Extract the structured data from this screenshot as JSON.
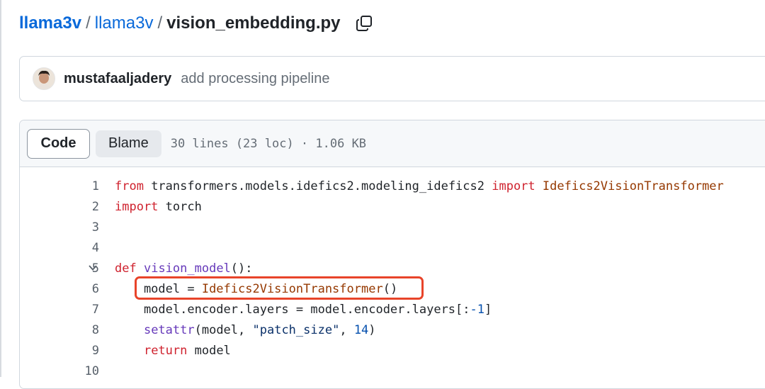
{
  "breadcrumb": {
    "owner": "llama3v",
    "repo": "llama3v",
    "separator": "/",
    "file": "vision_embedding.py"
  },
  "commit": {
    "author": "mustafaaljadery",
    "message": "add processing pipeline"
  },
  "file_header": {
    "code_label": "Code",
    "blame_label": "Blame",
    "meta": "30 lines (23 loc) · 1.06 KB"
  },
  "code": {
    "lines": [
      {
        "num": "1",
        "tokens": [
          {
            "t": "from",
            "c": "kw2"
          },
          {
            "t": " transformers.models.idefics2.modeling_idefics2 ",
            "c": ""
          },
          {
            "t": "import",
            "c": "kw2"
          },
          {
            "t": " ",
            "c": ""
          },
          {
            "t": "Idefics2VisionTransformer",
            "c": "cls"
          }
        ]
      },
      {
        "num": "2",
        "tokens": [
          {
            "t": "import",
            "c": "kw2"
          },
          {
            "t": " torch",
            "c": ""
          }
        ]
      },
      {
        "num": "3",
        "tokens": []
      },
      {
        "num": "4",
        "tokens": []
      },
      {
        "num": "5",
        "fold": true,
        "tokens": [
          {
            "t": "def",
            "c": "kw2"
          },
          {
            "t": " ",
            "c": ""
          },
          {
            "t": "vision_model",
            "c": "fn"
          },
          {
            "t": "():",
            "c": ""
          }
        ]
      },
      {
        "num": "6",
        "tokens": [
          {
            "t": "    model = ",
            "c": ""
          },
          {
            "t": "Idefics2VisionTransformer",
            "c": "cls"
          },
          {
            "t": "()",
            "c": ""
          }
        ]
      },
      {
        "num": "7",
        "tokens": [
          {
            "t": "    model.encoder.layers = model.encoder.layers[:",
            "c": ""
          },
          {
            "t": "-1",
            "c": "num"
          },
          {
            "t": "]",
            "c": ""
          }
        ]
      },
      {
        "num": "8",
        "tokens": [
          {
            "t": "    ",
            "c": ""
          },
          {
            "t": "setattr",
            "c": "fn"
          },
          {
            "t": "(model, ",
            "c": ""
          },
          {
            "t": "\"patch_size\"",
            "c": "str"
          },
          {
            "t": ", ",
            "c": ""
          },
          {
            "t": "14",
            "c": "num"
          },
          {
            "t": ")",
            "c": ""
          }
        ]
      },
      {
        "num": "9",
        "tokens": [
          {
            "t": "    ",
            "c": ""
          },
          {
            "t": "return",
            "c": "kw2"
          },
          {
            "t": " model",
            "c": ""
          }
        ]
      },
      {
        "num": "10",
        "tokens": []
      }
    ]
  },
  "colors": {
    "link": "#0969da",
    "keyword": "#cf222e",
    "class": "#953800",
    "function": "#6639ba",
    "string": "#0a3069",
    "number": "#0550ae",
    "annotation": "#e8442a"
  }
}
